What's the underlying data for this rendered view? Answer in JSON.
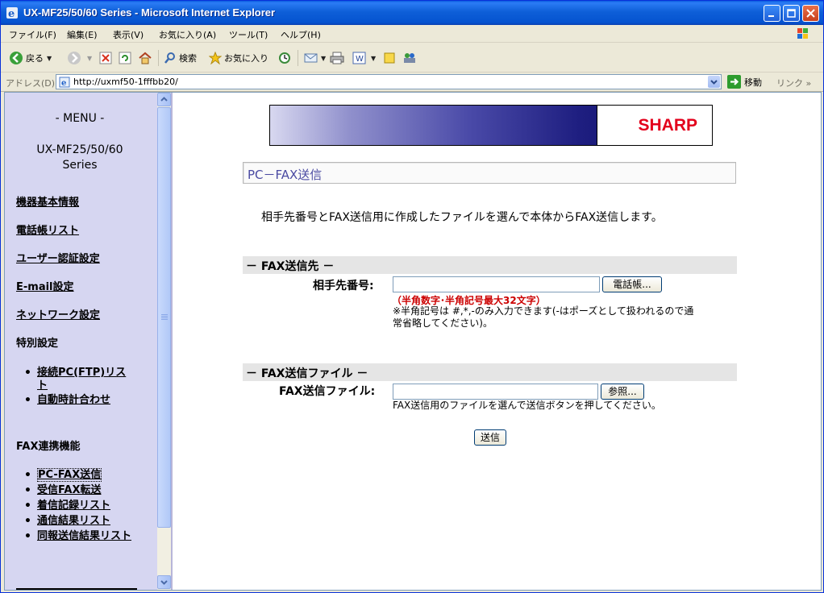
{
  "window": {
    "title": "UX-MF25/50/60 Series - Microsoft Internet Explorer"
  },
  "menubar": {
    "items": [
      "ファイル(F)",
      "編集(E)",
      "表示(V)",
      "お気に入り(A)",
      "ツール(T)",
      "ヘルプ(H)"
    ]
  },
  "toolbar": {
    "back": "戻る",
    "search": "検索",
    "favorites": "お気に入り"
  },
  "address": {
    "label": "アドレス(D)",
    "url": "http://uxmf50-1fffbb20/",
    "go": "移動",
    "links": "リンク"
  },
  "sidebar": {
    "menu_title": "- MENU -",
    "model_line1": "UX-MF25/50/60",
    "model_line2": "Series",
    "links": [
      "機器基本情報",
      "電話帳リスト",
      "ユーザー認証設定",
      "E-mail設定",
      "ネットワーク設定"
    ],
    "special_heading": "特別設定",
    "special_items": [
      "接続PC(FTP)リスト",
      "自動時計合わせ"
    ],
    "fax_heading": "FAX連携機能",
    "fax_items": [
      "PC-FAX送信",
      "受信FAX転送",
      "着信記録リスト",
      "通信結果リスト",
      "同報送信結果リスト"
    ]
  },
  "main": {
    "brand": "SHARP",
    "page_title": "PC－FAX送信",
    "intro": "相手先番号とFAX送信用に作成したファイルを選んで本体からFAX送信します。",
    "dest_section": "－ FAX送信先 －",
    "dest_label": "相手先番号:",
    "dest_value": "",
    "phonebook_button": "電話帳...",
    "dest_warning": "（半角数字･半角記号最大32文字）",
    "dest_note_line1": "※半角記号は #,*,-のみ入力できます(-はポーズとして扱われるので通",
    "dest_note_line2": "常省略してください)。",
    "file_section": "－ FAX送信ファイル －",
    "file_label": "FAX送信ファイル:",
    "file_value": "",
    "browse_button": "参照...",
    "file_note": "FAX送信用のファイルを選んで送信ボタンを押してください。",
    "send_button": "送信"
  }
}
